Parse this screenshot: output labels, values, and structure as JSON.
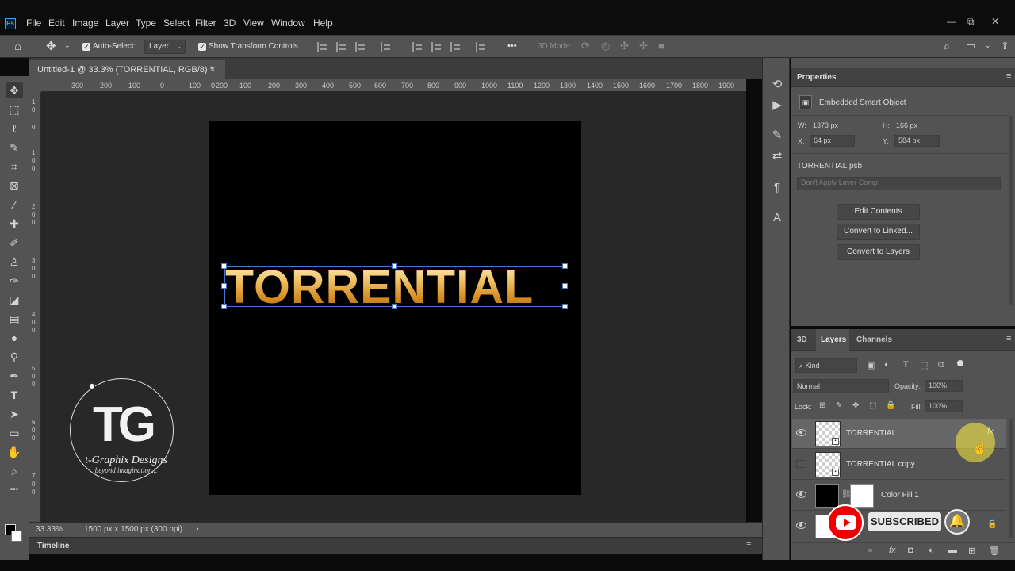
{
  "app": {
    "logo": "Ps",
    "menu": [
      "File",
      "Edit",
      "Image",
      "Layer",
      "Type",
      "Select",
      "Filter",
      "3D",
      "View",
      "Window",
      "Help"
    ],
    "window_controls": [
      "—",
      "⧉",
      "✕"
    ]
  },
  "options_bar": {
    "auto_select_label": "Auto-Select:",
    "auto_select_checked": true,
    "auto_select_target": "Layer",
    "show_transform_label": "Show Transform Controls",
    "show_transform_checked": true,
    "more": "•••",
    "mode_3d_label": "3D Mode:"
  },
  "document": {
    "tab_title": "Untitled-1 @ 33.3% (TORRENTIAL, RGB/8) *",
    "close": "×",
    "canvas_text": "TORRENTIAL",
    "zoom": "33.33%",
    "doc_info": "1500 px x 1500 px (300 ppi)"
  },
  "rulers": {
    "h_ticks": [
      "300",
      "200",
      "100",
      "0",
      "100",
      "200",
      "300",
      "400",
      "500",
      "600",
      "700",
      "800",
      "900",
      "1000",
      "1100",
      "1200",
      "1300",
      "1400",
      "1500",
      "1600",
      "1700",
      "1800",
      "1900",
      "2000",
      "2100"
    ],
    "v_ticks": [
      "1",
      "0",
      "0",
      "1",
      "0",
      "0",
      "2",
      "0",
      "0",
      "3",
      "0",
      "0",
      "4",
      "0",
      "0",
      "5",
      "0",
      "0",
      "6",
      "0",
      "0",
      "7",
      "0",
      "0",
      "8",
      "0",
      "0",
      "9",
      "0",
      "0",
      "1",
      "0",
      "0",
      "0",
      "1",
      "1",
      "0",
      "0",
      "1",
      "2",
      "0",
      "0",
      "1",
      "3",
      "0",
      "0",
      "1",
      "4",
      "0",
      "0",
      "1",
      "5",
      "0",
      "0",
      "1",
      "6",
      "0",
      "0"
    ]
  },
  "watermark": {
    "initials": "TG",
    "brand": "t-Graphix Designs",
    "tagline": "beyond imagination..."
  },
  "timeline": {
    "label": "Timeline"
  },
  "properties": {
    "title": "Properties",
    "object_type": "Embedded Smart Object",
    "w_label": "W:",
    "w_value": "1373 px",
    "h_label": "H:",
    "h_value": "166 px",
    "x_label": "X:",
    "x_value": "64 px",
    "y_label": "Y:",
    "y_value": "584 px",
    "filename": "TORRENTIAL.psb",
    "layer_comp_placeholder": "Don't Apply Layer Comp",
    "buttons": [
      "Edit Contents",
      "Convert to Linked...",
      "Convert to Layers"
    ]
  },
  "layers_panel": {
    "tabs": [
      "3D",
      "Layers",
      "Channels"
    ],
    "active_tab": "Layers",
    "filter_kind": "Kind",
    "blend_mode": "Normal",
    "opacity_label": "Opacity:",
    "opacity": "100%",
    "lock_label": "Lock:",
    "fill_label": "Fill:",
    "fill": "100%",
    "fx": "fx",
    "layers": [
      {
        "name": "TORRENTIAL",
        "visible": true,
        "selected": true,
        "type": "smart-object",
        "has_fx": true
      },
      {
        "name": "TORRENTIAL copy",
        "visible": false,
        "selected": false,
        "type": "smart-object"
      },
      {
        "name": "Color Fill 1",
        "visible": true,
        "selected": false,
        "type": "fill"
      },
      {
        "name": "Background",
        "visible": true,
        "selected": false,
        "type": "background",
        "locked": true
      }
    ]
  },
  "overlay": {
    "subscribe_label": "SUBSCRIBED",
    "youtube_color": "#e00000"
  },
  "colors": {
    "menubar": "#0c0c0c",
    "panel": "#535353",
    "workspace": "#282828",
    "canvas": "#000000",
    "text_gold": "#e0a33a",
    "selection": "#4a78c8"
  }
}
